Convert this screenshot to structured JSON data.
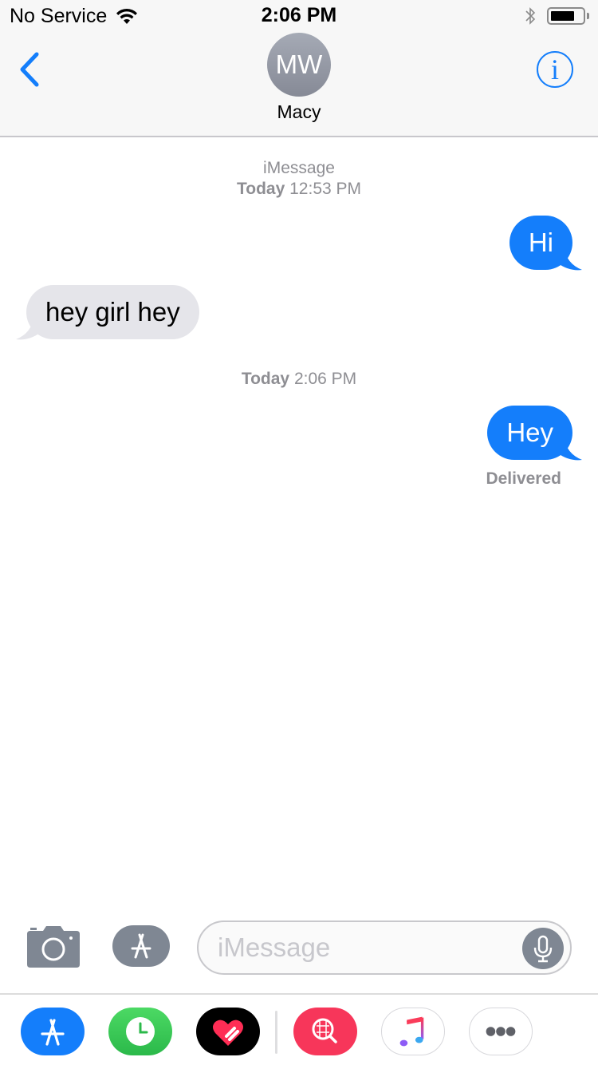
{
  "status_bar": {
    "carrier": "No Service",
    "time": "2:06 PM",
    "battery_level": 0.75,
    "icons": [
      "wifi-icon",
      "bluetooth-icon",
      "battery-icon"
    ]
  },
  "nav": {
    "back_icon": "chevron-left-icon",
    "avatar_initials": "MW",
    "contact_name": "Macy",
    "info_icon": "info-icon",
    "info_glyph": "i",
    "accent_color": "#147efb"
  },
  "conversation": {
    "header_service": "iMessage",
    "timestamps": [
      {
        "day": "Today",
        "time": "12:53 PM"
      },
      {
        "day": "Today",
        "time": "2:06 PM"
      }
    ],
    "messages": [
      {
        "direction": "sent",
        "text": "Hi"
      },
      {
        "direction": "received",
        "text": "hey girl hey"
      },
      {
        "direction": "sent",
        "text": "Hey"
      }
    ],
    "status": "Delivered",
    "colors": {
      "sent_bubble": "#147efb",
      "received_bubble": "#e5e5ea",
      "meta_text": "#8e8e93"
    }
  },
  "composer": {
    "camera_icon": "camera-icon",
    "apps_icon": "app-store-icon",
    "placeholder": "iMessage",
    "value": "",
    "mic_icon": "microphone-icon"
  },
  "app_drawer": {
    "apps": [
      {
        "name": "App Store",
        "icon": "app-store-icon",
        "color": "#147efb"
      },
      {
        "name": "Recents",
        "icon": "clock-icon",
        "color": "#34c759"
      },
      {
        "name": "Digital Touch",
        "icon": "heart-icon",
        "color": "#000000"
      },
      {
        "name": "Images Search",
        "icon": "globe-search-icon",
        "color": "#f7365a"
      },
      {
        "name": "Music",
        "icon": "music-note-icon",
        "color": "#ffffff"
      },
      {
        "name": "More",
        "icon": "more-icon",
        "color": "#ffffff"
      }
    ]
  }
}
